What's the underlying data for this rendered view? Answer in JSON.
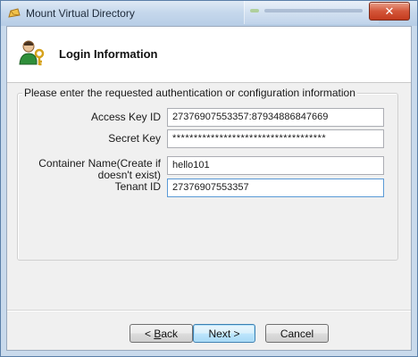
{
  "window": {
    "title": "Mount Virtual Directory",
    "close_label": "✕"
  },
  "header": {
    "title": "Login Information"
  },
  "group": {
    "caption": "Please enter the requested authentication or configuration information"
  },
  "fields": {
    "access_key": {
      "label": "Access Key ID",
      "value": "27376907553357:87934886847669"
    },
    "secret_key": {
      "label": "Secret Key",
      "value": "************************************"
    },
    "container": {
      "label_line1": "Container Name(Create if",
      "label_line2": "doesn't exist)",
      "value": "hello101"
    },
    "tenant": {
      "label": "Tenant ID",
      "value": "27376907553357"
    }
  },
  "buttons": {
    "back_prefix": "< ",
    "back_mnemonic": "B",
    "back_rest": "ack",
    "next": "Next >",
    "cancel": "Cancel"
  }
}
